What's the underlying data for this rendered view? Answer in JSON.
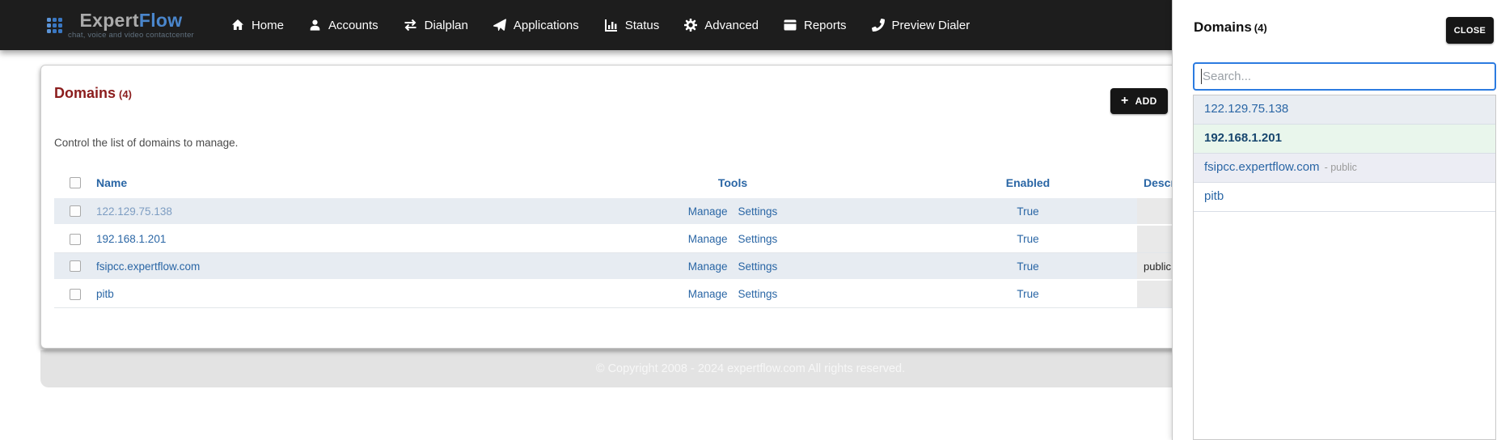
{
  "brand": {
    "name_primary": "Expert",
    "name_secondary": "Flow",
    "tagline": "chat, voice and video contactcenter",
    "logo_icon": "dots-grid-icon"
  },
  "nav": {
    "items": [
      {
        "label": "Home",
        "icon": "home-icon"
      },
      {
        "label": "Accounts",
        "icon": "user-icon"
      },
      {
        "label": "Dialplan",
        "icon": "swap-arrows-icon"
      },
      {
        "label": "Applications",
        "icon": "paper-plane-icon"
      },
      {
        "label": "Status",
        "icon": "bar-chart-icon"
      },
      {
        "label": "Advanced",
        "icon": "gear-icon"
      },
      {
        "label": "Reports",
        "icon": "window-icon"
      },
      {
        "label": "Preview Dialer",
        "icon": "phone-icon"
      }
    ]
  },
  "main": {
    "heading": "Domains",
    "heading_count": "(4)",
    "add_button": "ADD",
    "add_icon": "plus-icon",
    "description": "Control the list of domains to manage.",
    "table": {
      "headers": {
        "name": "Name",
        "tools": "Tools",
        "enabled": "Enabled",
        "description": "Description"
      },
      "rows": [
        {
          "name": "122.129.75.138",
          "tools": [
            "Manage",
            "Settings"
          ],
          "enabled": "True",
          "description": ""
        },
        {
          "name": "192.168.1.201",
          "tools": [
            "Manage",
            "Settings"
          ],
          "enabled": "True",
          "description": ""
        },
        {
          "name": "fsipcc.expertflow.com",
          "tools": [
            "Manage",
            "Settings"
          ],
          "enabled": "True",
          "description": "public"
        },
        {
          "name": "pitb",
          "tools": [
            "Manage",
            "Settings"
          ],
          "enabled": "True",
          "description": ""
        }
      ]
    },
    "footer": "© Copyright 2008 - 2024 expertflow.com All rights reserved."
  },
  "panel": {
    "heading": "Domains",
    "heading_count": "(4)",
    "close_button": "CLOSE",
    "search": {
      "value": "",
      "placeholder": "Search..."
    },
    "items": [
      {
        "label": "122.129.75.138",
        "suffix": "",
        "selected": false
      },
      {
        "label": "192.168.1.201",
        "suffix": "",
        "selected": true
      },
      {
        "label": "fsipcc.expertflow.com",
        "suffix": "- public",
        "selected": false
      },
      {
        "label": "pitb",
        "suffix": "",
        "selected": false
      }
    ]
  },
  "colors": {
    "nav_bg": "#1d1d1d",
    "logo_blue": "#4a86cc",
    "heading_maroon": "#8b1d1d",
    "link_blue": "#2a66a5",
    "muted_link_blue": "#7d9dc2",
    "stripe_row_bg": "#e7ecf2",
    "description_cell_bg": "#e9e9e9",
    "button_bg": "#161616",
    "search_border_blue": "#2c7be0",
    "selected_item_bg": "#e9f6ec",
    "footer_bg": "#e3e3e3"
  }
}
